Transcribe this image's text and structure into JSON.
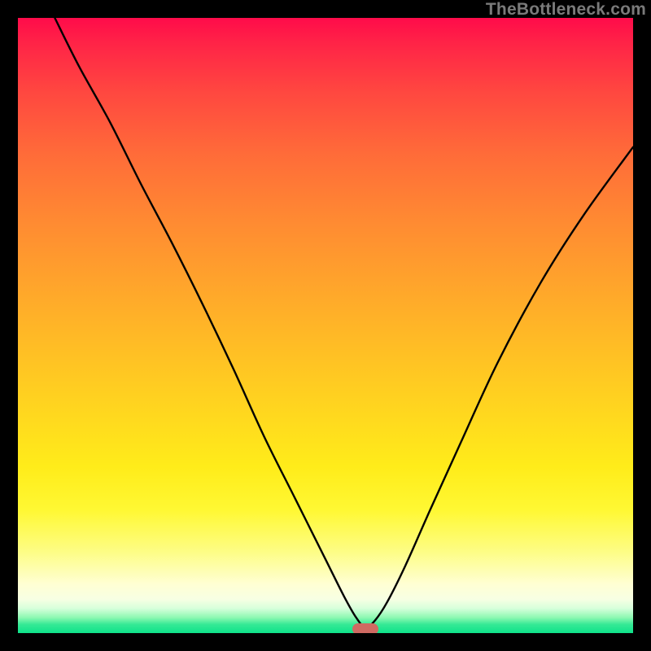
{
  "watermark": "TheBottleneck.com",
  "marker": {
    "x_pct": 56.5,
    "y_pct": 99.3
  },
  "colors": {
    "frame": "#000000",
    "marker": "#cf6a62",
    "watermark": "#7a7a7a",
    "curve": "#000000"
  },
  "chart_data": {
    "type": "line",
    "title": "",
    "xlabel": "",
    "ylabel": "",
    "xlim": [
      0,
      100
    ],
    "ylim": [
      0,
      100
    ],
    "grid": false,
    "legend": false,
    "series": [
      {
        "name": "bottleneck-curve",
        "x": [
          6,
          10,
          15,
          20,
          25,
          30,
          35,
          40,
          45,
          50,
          53,
          55,
          56.5,
          58,
          60,
          63,
          67,
          72,
          78,
          85,
          92,
          100
        ],
        "y": [
          100,
          92,
          83,
          73,
          63.5,
          53.5,
          43,
          32,
          22,
          12,
          6,
          2.5,
          0.9,
          2,
          5,
          11,
          20,
          31,
          44,
          57,
          68,
          79
        ]
      }
    ],
    "annotations": [
      {
        "type": "marker",
        "x": 56.5,
        "y": 0.9,
        "label": "optimal-point"
      }
    ]
  }
}
